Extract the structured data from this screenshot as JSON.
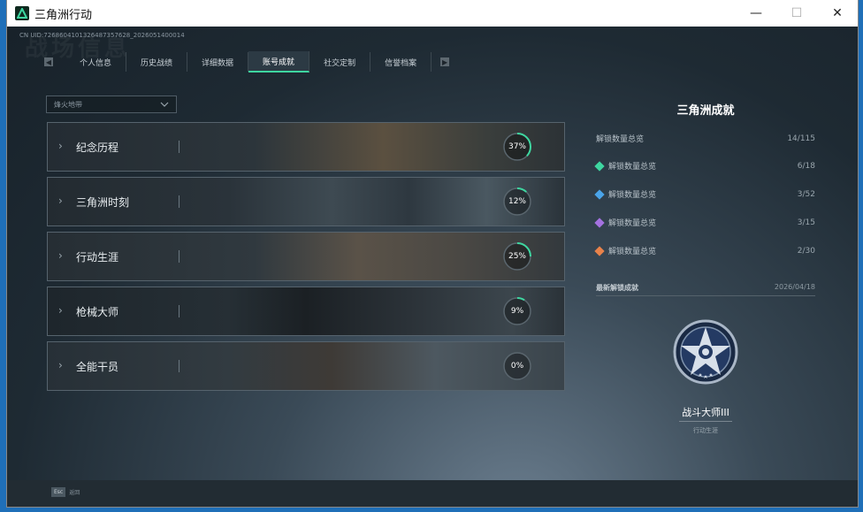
{
  "window": {
    "title": "三角洲行动",
    "minimize": "—",
    "maximize": "☐",
    "close": "✕"
  },
  "uid": "CN UID:7268604101326487357628_2026051400014",
  "bg_text": "战场信息",
  "tabs": [
    {
      "label": "个人信息",
      "active": false
    },
    {
      "label": "历史战绩",
      "active": false
    },
    {
      "label": "详细数据",
      "active": false
    },
    {
      "label": "账号成就",
      "active": true
    },
    {
      "label": "社交定制",
      "active": false
    },
    {
      "label": "信誉档案",
      "active": false
    }
  ],
  "filter": {
    "value": "烽火地带"
  },
  "categories": [
    {
      "label": "纪念历程",
      "progress": 37,
      "progress_text": "37%"
    },
    {
      "label": "三角洲时刻",
      "progress": 12,
      "progress_text": "12%"
    },
    {
      "label": "行动生涯",
      "progress": 25,
      "progress_text": "25%"
    },
    {
      "label": "枪械大师",
      "progress": 9,
      "progress_text": "9%"
    },
    {
      "label": "全能干员",
      "progress": 0,
      "progress_text": "0%"
    }
  ],
  "summary": {
    "title": "三角洲成就",
    "total_label": "解锁数量总览",
    "total_value": "14/115",
    "tiers": [
      {
        "label": "解锁数量总览",
        "value": "6/18",
        "color": "#3ed6a0"
      },
      {
        "label": "解锁数量总览",
        "value": "3/52",
        "color": "#4aa3e8"
      },
      {
        "label": "解锁数量总览",
        "value": "3/15",
        "color": "#a472e0"
      },
      {
        "label": "解锁数量总览",
        "value": "2/30",
        "color": "#e8824a"
      }
    ],
    "latest_label": "最新解锁成就",
    "latest_date": "2026/04/18",
    "medal_name": "战斗大师III",
    "medal_category": "行动生涯"
  },
  "bottom": {
    "key": "Esc",
    "label": "返回"
  },
  "colors": {
    "accent": "#3ed6a0"
  }
}
